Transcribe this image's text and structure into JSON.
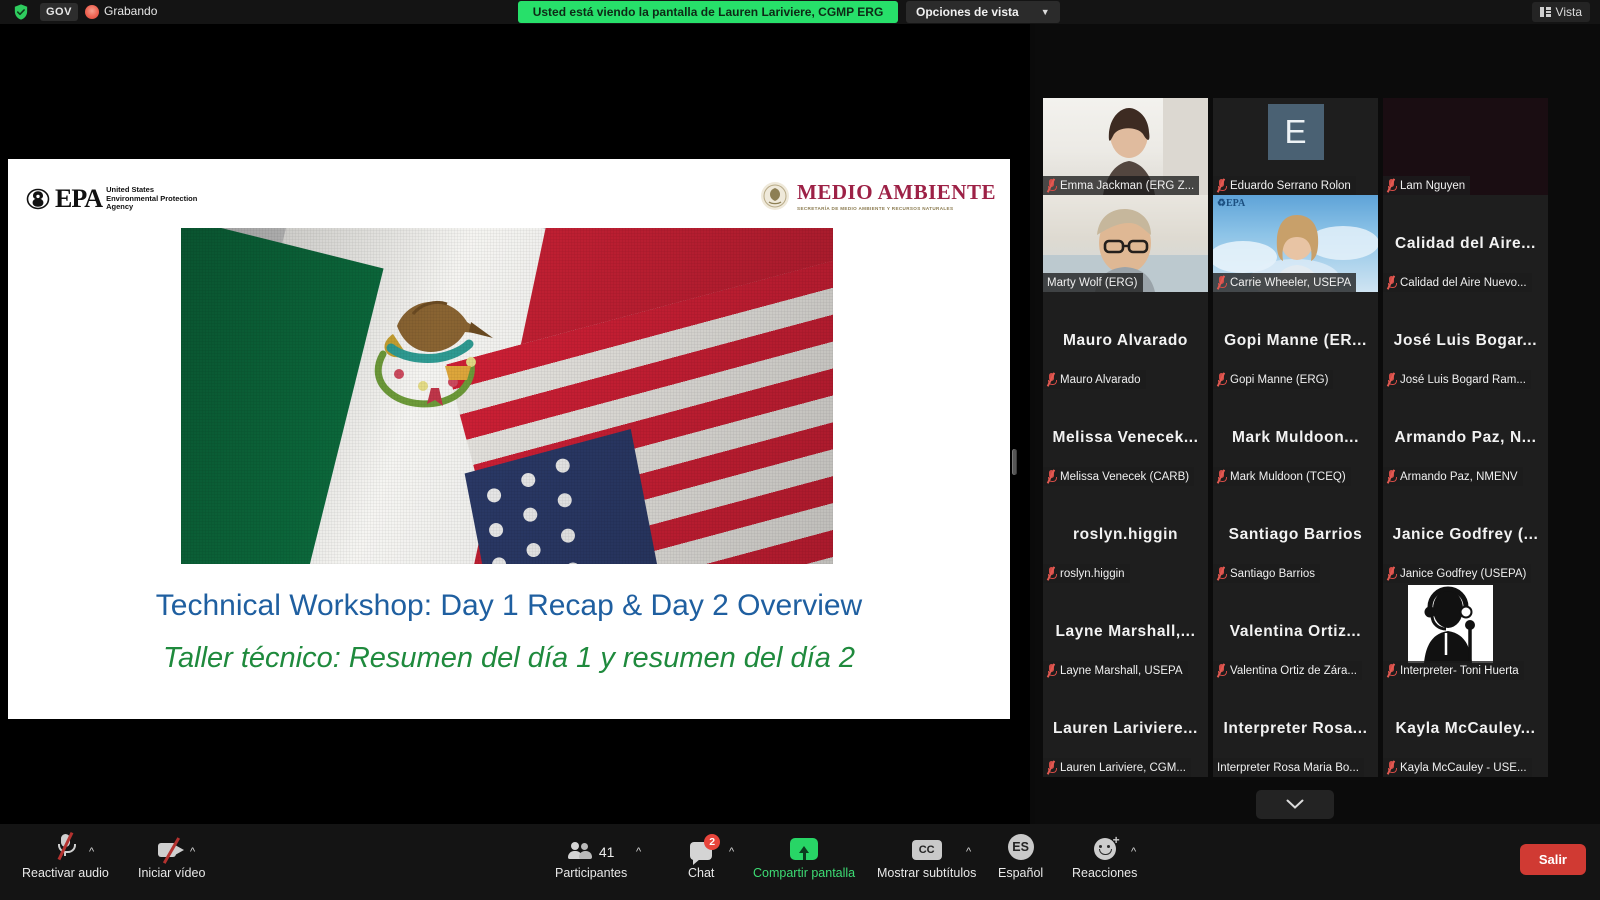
{
  "topbar": {
    "gov_badge": "GOV",
    "recording_label": "Grabando",
    "share_banner": "Usted está viendo la pantalla de Lauren Lariviere, CGMP ERG",
    "view_options": "Opciones de vista",
    "view_button": "Vista"
  },
  "slide": {
    "epa_wordmark": "EPA",
    "epa_line1": "United States",
    "epa_line2": "Environmental Protection",
    "epa_line3": "Agency",
    "semarnat_title": "MEDIO AMBIENTE",
    "semarnat_subtitle": "SECRETARÍA DE MEDIO AMBIENTE Y RECURSOS NATURALES",
    "title_en": "Technical Workshop: Day 1 Recap & Day 2 Overview",
    "title_es": "Taller técnico: Resumen del día 1 y resumen del día 2",
    "title_en_color": "#1f5fa0",
    "title_es_color": "#1f8a3d"
  },
  "gallery": {
    "active_speaker_border": "#cfe84b",
    "scroll_down_label": "chevron-down-icon",
    "tiles": [
      {
        "name": "Emma Jackman (ERG Z...",
        "display": "",
        "kind": "video",
        "muted": true,
        "video": "woman-light-room"
      },
      {
        "name": "Eduardo Serrano Rolon",
        "display": "",
        "kind": "avatar",
        "muted": true,
        "initial": "E"
      },
      {
        "name": "Lam Nguyen",
        "display": "",
        "kind": "dark",
        "muted": true
      },
      {
        "name": "Marty Wolf (ERG)",
        "display": "",
        "kind": "video",
        "muted": false,
        "active": true,
        "video": "man-glasses-office"
      },
      {
        "name": "Carrie Wheeler, USEPA",
        "display": "",
        "kind": "video",
        "muted": true,
        "video": "woman-epa-sky-background",
        "badge": "EPA"
      },
      {
        "name": "Calidad del Aire Nuevo...",
        "display": "Calidad del Aire...",
        "kind": "name",
        "muted": true
      },
      {
        "name": "Mauro Alvarado",
        "display": "Mauro Alvarado",
        "kind": "name",
        "muted": true
      },
      {
        "name": "Gopi Manne (ERG)",
        "display": "Gopi Manne (ER...",
        "kind": "name",
        "muted": true
      },
      {
        "name": "José Luis Bogard Ram...",
        "display": "José Luis Bogar...",
        "kind": "name",
        "muted": true
      },
      {
        "name": "Melissa Venecek (CARB)",
        "display": "Melissa  Venecek...",
        "kind": "name",
        "muted": true
      },
      {
        "name": "Mark Muldoon (TCEQ)",
        "display": "Mark Muldoon...",
        "kind": "name",
        "muted": true
      },
      {
        "name": "Armando Paz, NMENV",
        "display": "Armando Paz, N...",
        "kind": "name",
        "muted": true
      },
      {
        "name": "roslyn.higgin",
        "display": "roslyn.higgin",
        "kind": "name",
        "muted": true
      },
      {
        "name": "Santiago Barrios",
        "display": "Santiago Barrios",
        "kind": "name",
        "muted": true
      },
      {
        "name": "Janice Godfrey (USEPA)",
        "display": "Janice Godfrey (...",
        "kind": "name",
        "muted": true
      },
      {
        "name": "Layne Marshall, USEPA",
        "display": "Layne  Marshall,...",
        "kind": "name",
        "muted": true
      },
      {
        "name": "Valentina Ortiz de Zára...",
        "display": "Valentina  Ortiz...",
        "kind": "name",
        "muted": true
      },
      {
        "name": "Interpreter- Toni Huerta",
        "display": "",
        "kind": "image",
        "muted": true,
        "image": "interpreter-headset-icon"
      },
      {
        "name": "Lauren Lariviere, CGM...",
        "display": "Lauren  Lariviere...",
        "kind": "name",
        "muted": true
      },
      {
        "name": "Interpreter Rosa Maria Bo...",
        "display": "Interpreter  Rosa...",
        "kind": "name",
        "muted": false
      },
      {
        "name": "Kayla McCauley - USE...",
        "display": "Kayla  McCauley...",
        "kind": "name",
        "muted": true
      }
    ]
  },
  "toolbar": {
    "unmute_label": "Reactivar audio",
    "start_video_label": "Iniciar vídeo",
    "participants_label": "Participantes",
    "participants_count": "41",
    "chat_label": "Chat",
    "chat_badge": "2",
    "share_label": "Compartir pantalla",
    "captions_label": "Mostrar subtítulos",
    "captions_icon_text": "CC",
    "language_label": "Español",
    "language_icon_text": "ES",
    "reactions_label": "Reacciones",
    "leave_label": "Salir",
    "leave_color": "#d03a33",
    "share_color": "#3ddc74"
  }
}
